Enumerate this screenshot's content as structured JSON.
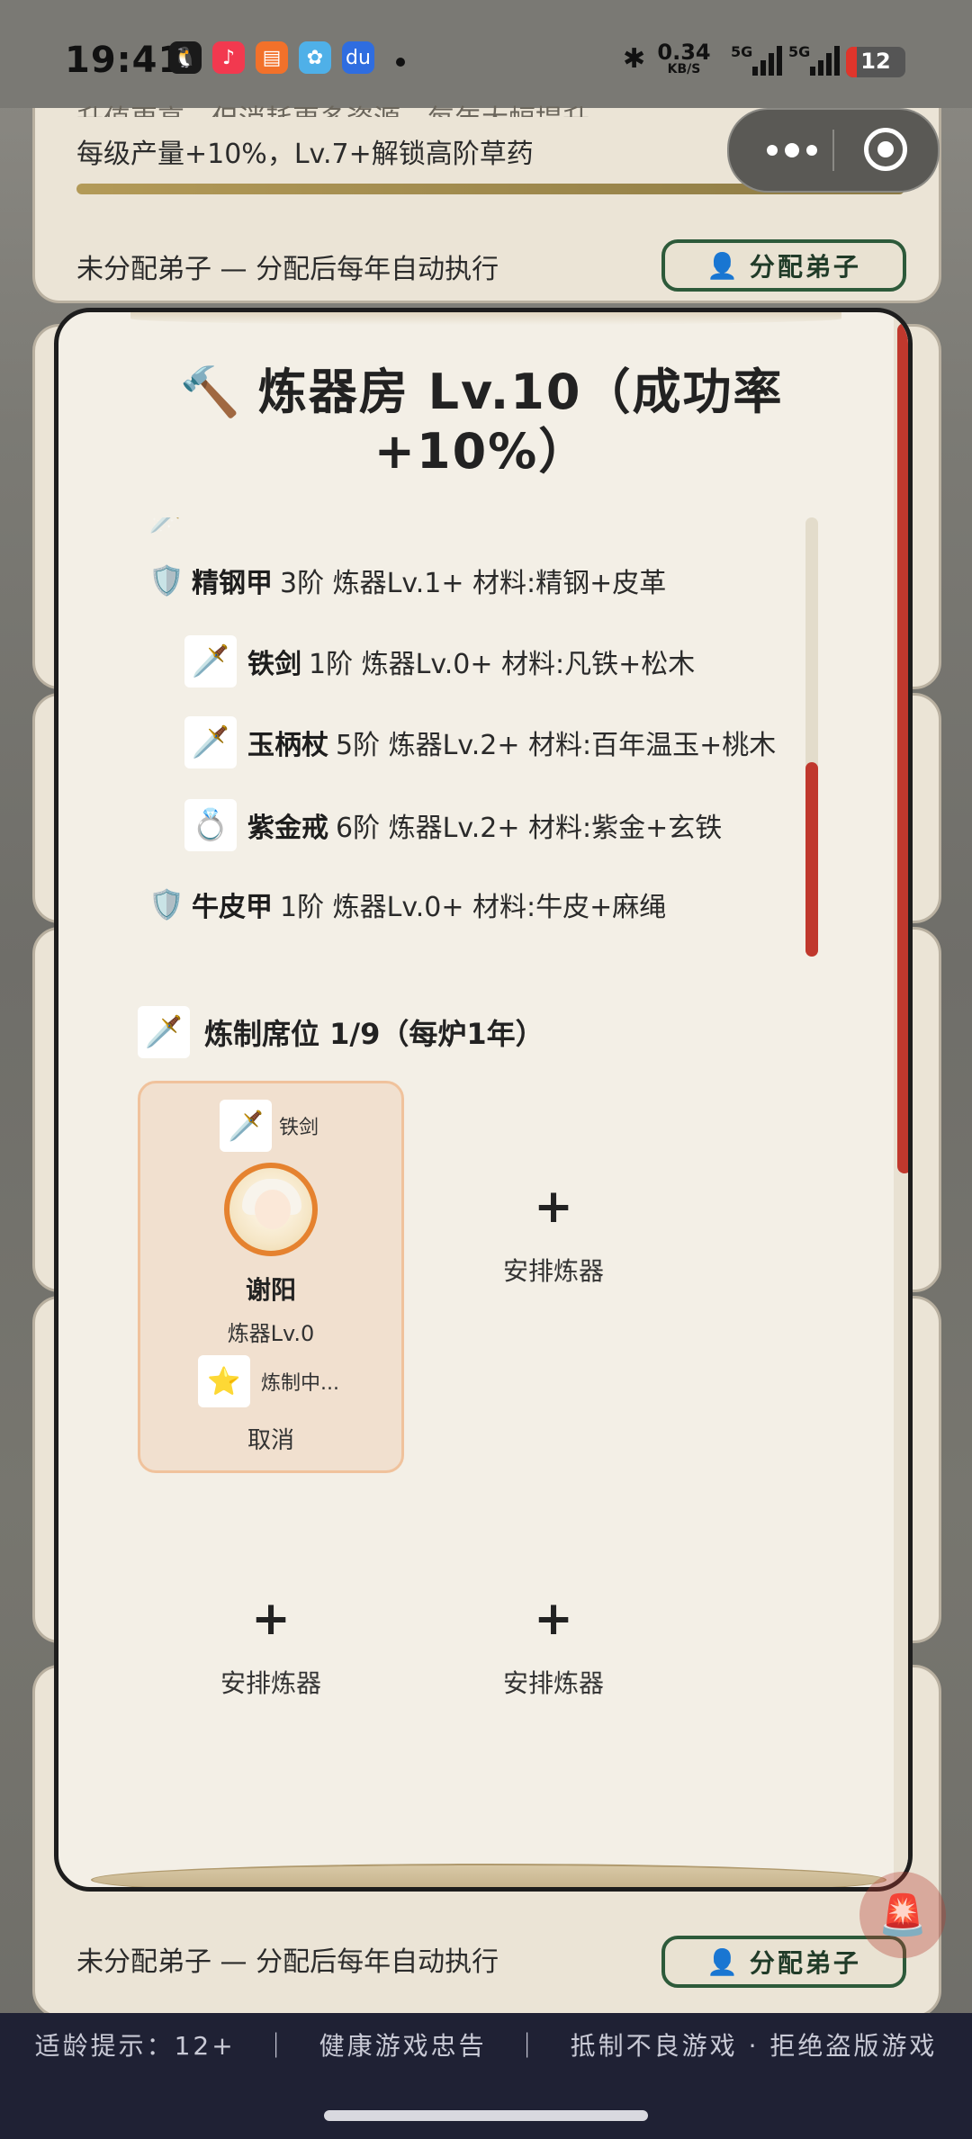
{
  "status_bar": {
    "time": "19:41",
    "net_speed_value": "0.34",
    "net_speed_unit": "KB/S",
    "signal_1": "5G",
    "signal_2": "5G",
    "battery": "12"
  },
  "background": {
    "top_panel": {
      "truncated_line": "升值更高，但消耗更多资源，每年大幅提升",
      "bonus_text": "每级产量+10%，Lv.7+解锁高阶草药",
      "progress": 1.0,
      "status_text": "未分配弟子 — 分配后每年自动执行",
      "assign_label": "分配弟子"
    },
    "bottom_panel": {
      "status_text": "未分配弟子 — 分配后每年自动执行",
      "assign_label": "分配弟子"
    }
  },
  "modal": {
    "title": "炼器房 Lv.10（成功率+10%）",
    "title_icon": "hammer-icon",
    "recipes": [
      {
        "icon": "shield-icon",
        "name": "精钢甲",
        "detail": "3阶 炼器Lv.1+ 材料:精钢+皮革"
      },
      {
        "icon": "sword-icon",
        "name": "铁剑",
        "detail": "1阶 炼器Lv.0+ 材料:凡铁+松木"
      },
      {
        "icon": "sword-icon",
        "name": "玉柄杖",
        "detail": "5阶 炼器Lv.2+ 材料:百年温玉+桃木"
      },
      {
        "icon": "ring-icon",
        "name": "紫金戒",
        "detail": "6阶 炼器Lv.2+ 材料:紫金+玄铁"
      },
      {
        "icon": "shield-icon",
        "name": "牛皮甲",
        "detail": "1阶 炼器Lv.0+ 材料:牛皮+麻绳"
      }
    ],
    "seat_header": "炼制席位 1/9（每炉1年）",
    "active_slot": {
      "item_name": "铁剑",
      "disciple_name": "谢阳",
      "disciple_level": "炼器Lv.0",
      "status": "炼制中...",
      "cancel_label": "取消"
    },
    "empty_slot": {
      "plus": "+",
      "label": "安排炼器"
    }
  },
  "footer": {
    "text": "适龄提示：12+　｜　健康游戏忠告　｜　抵制不良游戏 · 拒绝盗版游戏"
  },
  "colors": {
    "accent_red": "#c0382d",
    "panel_bg": "#f3efe6",
    "active_slot_bg": "#f1e0cf",
    "avatar_ring": "#e5822f",
    "assign_button_border": "#2d5a3a"
  }
}
